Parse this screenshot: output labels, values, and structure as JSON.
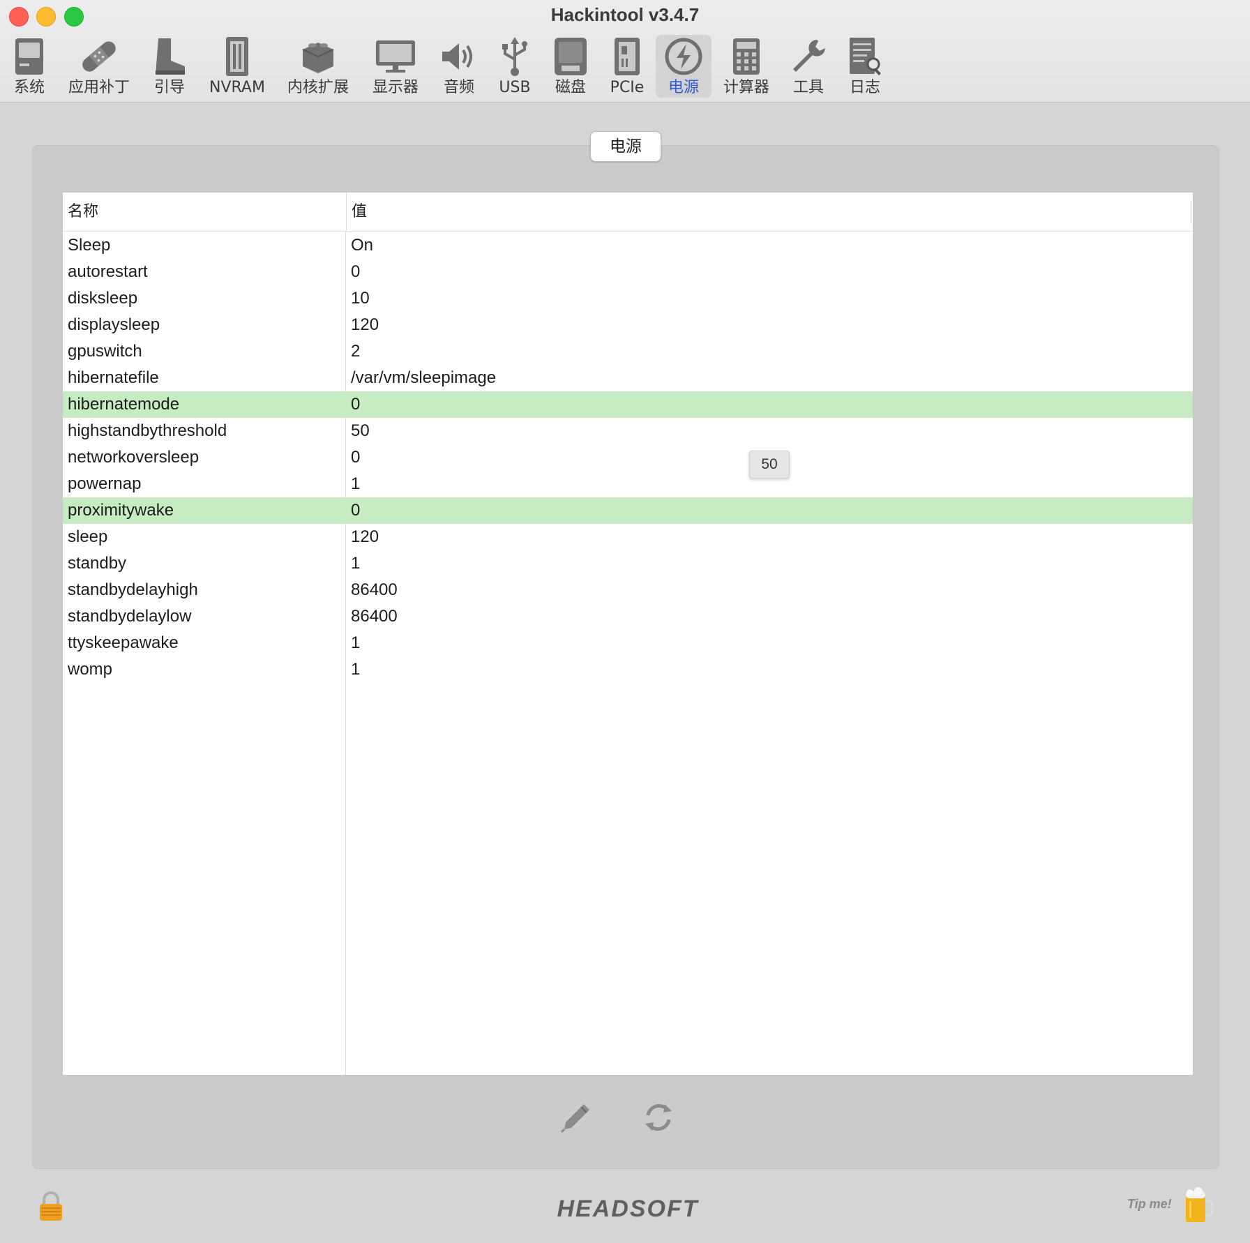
{
  "window": {
    "title": "Hackintool v3.4.7"
  },
  "toolbar": {
    "items": [
      {
        "label": "系统",
        "icon": "computer-icon"
      },
      {
        "label": "应用补丁",
        "icon": "bandage-icon"
      },
      {
        "label": "引导",
        "icon": "boot-icon"
      },
      {
        "label": "NVRAM",
        "icon": "nvram-icon"
      },
      {
        "label": "内核扩展",
        "icon": "kext-icon"
      },
      {
        "label": "显示器",
        "icon": "display-icon"
      },
      {
        "label": "音频",
        "icon": "speaker-icon"
      },
      {
        "label": "USB",
        "icon": "usb-icon"
      },
      {
        "label": "磁盘",
        "icon": "disk-icon"
      },
      {
        "label": "PCIe",
        "icon": "pcie-icon"
      },
      {
        "label": "电源",
        "icon": "power-icon"
      },
      {
        "label": "计算器",
        "icon": "calculator-icon"
      },
      {
        "label": "工具",
        "icon": "wrench-icon"
      },
      {
        "label": "日志",
        "icon": "log-icon"
      }
    ],
    "active": "电源"
  },
  "panel": {
    "title": "电源"
  },
  "table": {
    "headers": {
      "name": "名称",
      "value": "值"
    },
    "rows": [
      {
        "name": "Sleep",
        "value": "On",
        "highlighted": false
      },
      {
        "name": "autorestart",
        "value": "0",
        "highlighted": false
      },
      {
        "name": "disksleep",
        "value": "10",
        "highlighted": false
      },
      {
        "name": "displaysleep",
        "value": "120",
        "highlighted": false
      },
      {
        "name": "gpuswitch",
        "value": "2",
        "highlighted": false
      },
      {
        "name": "hibernatefile",
        "value": "/var/vm/sleepimage",
        "highlighted": false
      },
      {
        "name": "hibernatemode",
        "value": "0",
        "highlighted": true
      },
      {
        "name": "highstandbythreshold",
        "value": "50",
        "highlighted": false
      },
      {
        "name": "networkoversleep",
        "value": "0",
        "highlighted": false
      },
      {
        "name": "powernap",
        "value": "1",
        "highlighted": false
      },
      {
        "name": "proximitywake",
        "value": "0",
        "highlighted": true
      },
      {
        "name": "sleep",
        "value": "120",
        "highlighted": false
      },
      {
        "name": "standby",
        "value": "1",
        "highlighted": false
      },
      {
        "name": "standbydelayhigh",
        "value": "86400",
        "highlighted": false
      },
      {
        "name": "standbydelaylow",
        "value": "86400",
        "highlighted": false
      },
      {
        "name": "ttyskeepawake",
        "value": "1",
        "highlighted": false
      },
      {
        "name": "womp",
        "value": "1",
        "highlighted": false
      }
    ]
  },
  "tooltip": {
    "text": "50"
  },
  "actions": {
    "edit_icon": "pencil-icon",
    "refresh_icon": "refresh-icon"
  },
  "footer": {
    "brand": "HEADSOFT",
    "tip": "Tip me!",
    "lock_icon": "lock-icon",
    "beer_icon": "beer-icon"
  },
  "colors": {
    "highlight": "#c7ebc2",
    "active_label": "#2f5cd6"
  }
}
